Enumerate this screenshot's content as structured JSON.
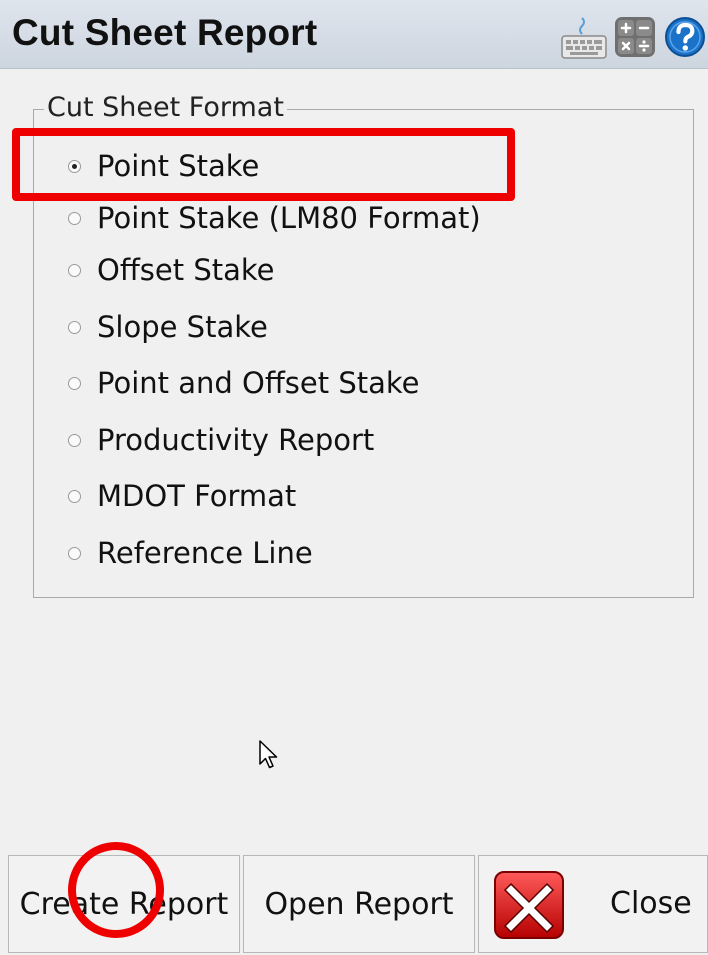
{
  "window": {
    "title": "Cut Sheet Report",
    "title_icons": [
      "keyboard-icon",
      "calculator-icon",
      "help-icon"
    ]
  },
  "format_group": {
    "legend": "Cut Sheet Format",
    "selected": "Point Stake",
    "options": [
      {
        "label": "Point Stake",
        "checked": true
      },
      {
        "label": "Point Stake (LM80 Format)",
        "checked": false
      },
      {
        "label": "Offset Stake",
        "checked": false
      },
      {
        "label": "Slope Stake",
        "checked": false
      },
      {
        "label": "Point and Offset Stake",
        "checked": false
      },
      {
        "label": "Productivity Report",
        "checked": false
      },
      {
        "label": "MDOT Format",
        "checked": false
      },
      {
        "label": "Reference Line",
        "checked": false
      }
    ]
  },
  "buttons": {
    "create": "Create Report",
    "open": "Open Report",
    "close": "Close"
  },
  "colors": {
    "annotation": "#ee0000",
    "titlebar": "#cdd5df",
    "help_blue": "#1a73c9"
  }
}
